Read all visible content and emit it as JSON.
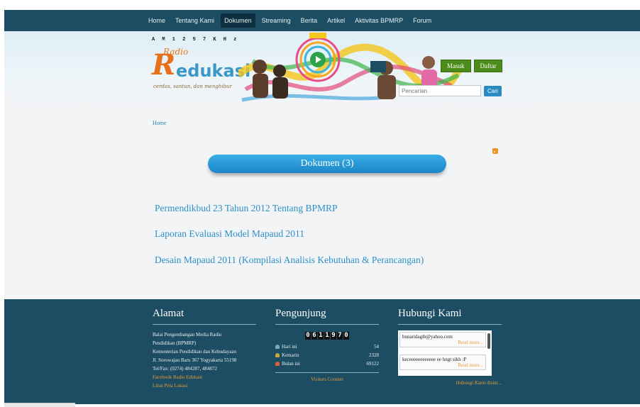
{
  "nav": {
    "items": [
      {
        "label": "Home"
      },
      {
        "label": "Tentang Kami"
      },
      {
        "label": "Dokumen",
        "active": true
      },
      {
        "label": "Streaming"
      },
      {
        "label": "Berita"
      },
      {
        "label": "Artikel"
      },
      {
        "label": "Aktivitas BPMRP"
      },
      {
        "label": "Forum"
      }
    ]
  },
  "header": {
    "logo": {
      "am": "A M   1 2 5 7 K H z",
      "radio": "Radio",
      "r": "R",
      "edukasi": "edukasi",
      "tagline": "cerdas, santun, dan menghibur"
    },
    "masuk_label": "Masuk",
    "daftar_label": "Daftar",
    "search_placeholder": "Pencarian",
    "search_button": "Cari"
  },
  "breadcrumb": {
    "home": "Home"
  },
  "main": {
    "title": "Dokumen (3)",
    "documents": [
      "Permendikbud 23 Tahun 2012 Tentang BPMRP",
      "Laporan Evaluasi Model Mapaud 2011",
      "Desain Mapaud 2011 (Kompilasi Analisis Kebutuhan & Perancangan)"
    ]
  },
  "footer": {
    "alamat": {
      "title": "Alamat",
      "lines": [
        "Balai Pengembangan Media Radio",
        "Pendidikan (BPMRP)",
        "Kementerian Pendidikan dan Kebudayaan",
        "Jl. Sorowajan Baru 367 Yogyakarta 55198",
        "Tel/Fax: (0274) 484287, 484872"
      ],
      "facebook": "Facebook Radio Edukasi",
      "map": "Lihat Peta Lokasi"
    },
    "pengunjung": {
      "title": "Pengunjung",
      "counter": [
        "0",
        "6",
        "1",
        "1",
        "9",
        "7",
        "0"
      ],
      "rows": [
        {
          "label": "Hari ini",
          "value": "54",
          "color": "#7aa6c8"
        },
        {
          "label": "Kemarin",
          "value": "2328",
          "color": "#c9a640"
        },
        {
          "label": "Bulan ini",
          "value": "69122",
          "color": "#d9603a"
        }
      ],
      "footer_link": "Visitors Counter"
    },
    "hubungi": {
      "title": "Hubungi Kami",
      "messages": [
        {
          "text": "bunaridagib@yahoo.com",
          "more": "Read more..."
        },
        {
          "text": "keceeeeeeeeeeee ee bngt sikh :P",
          "more": "Read more..."
        }
      ],
      "link": "Hubungi Kami disini..."
    }
  }
}
